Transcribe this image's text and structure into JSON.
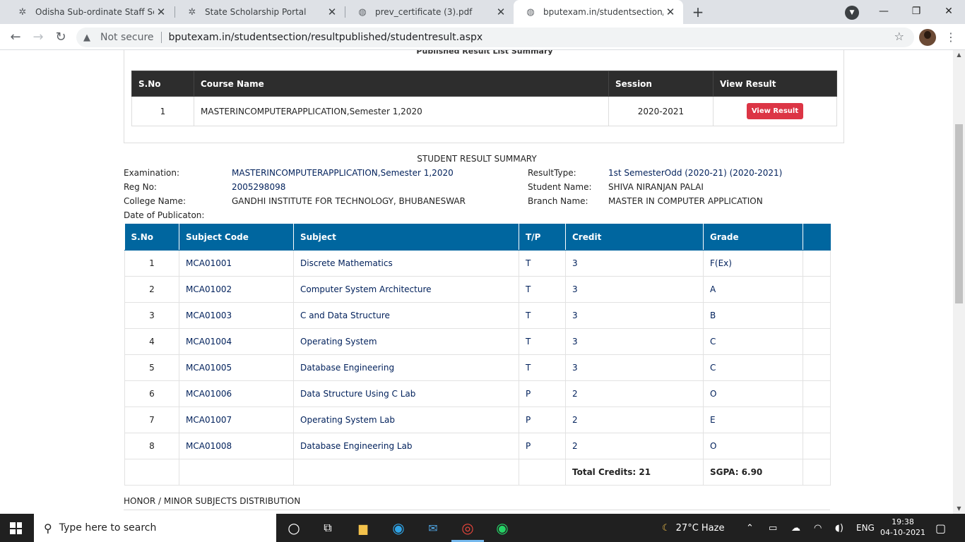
{
  "browser": {
    "tabs": [
      {
        "title": "Odisha Sub-ordinate Staff Selecti",
        "icon": "osssc-icon",
        "active": false
      },
      {
        "title": "State Scholarship Portal",
        "icon": "scholarship-icon",
        "active": false
      },
      {
        "title": "prev_certificate (3).pdf",
        "icon": "globe-icon",
        "active": false
      },
      {
        "title": "bputexam.in/studentsection/resu",
        "icon": "globe-icon",
        "active": true
      }
    ],
    "new_tab": "+",
    "address": {
      "security": "Not secure",
      "url": "bputexam.in/studentsection/resultpublished/studentresult.aspx"
    }
  },
  "published": {
    "heading": "Published Result  List Summary",
    "headers": [
      "S.No",
      "Course Name",
      "Session",
      "View Result"
    ],
    "row": {
      "sno": "1",
      "course": "MASTERINCOMPUTERAPPLICATION,Semester 1,2020",
      "session": "2020-2021",
      "button": "View Result"
    }
  },
  "summary": {
    "title": "STUDENT RESULT SUMMARY",
    "examination_label": "Examination:",
    "examination": "MASTERINCOMPUTERAPPLICATION,Semester 1,2020",
    "regno_label": "Reg No:",
    "regno": "2005298098",
    "college_label": "College Name:",
    "college": "GANDHI INSTITUTE FOR TECHNOLOGY, BHUBANESWAR",
    "date_label": "Date of Publicaton:",
    "resulttype_label": "ResultType:",
    "resulttype": "1st SemesterOdd (2020-21) (2020-2021)",
    "student_label": "Student Name:",
    "student": "SHIVA NIRANJAN PALAI",
    "branch_label": "Branch Name:",
    "branch": "MASTER IN COMPUTER APPLICATION"
  },
  "grades": {
    "headers": [
      "S.No",
      "Subject Code",
      "Subject",
      "T/P",
      "Credit",
      "Grade",
      ""
    ],
    "rows": [
      {
        "sno": "1",
        "code": "MCA01001",
        "subject": "Discrete Mathematics",
        "tp": "T",
        "credit": "3",
        "grade": "F(Ex)"
      },
      {
        "sno": "2",
        "code": "MCA01002",
        "subject": "Computer System Architecture",
        "tp": "T",
        "credit": "3",
        "grade": "A"
      },
      {
        "sno": "3",
        "code": "MCA01003",
        "subject": "C and Data Structure",
        "tp": "T",
        "credit": "3",
        "grade": "B"
      },
      {
        "sno": "4",
        "code": "MCA01004",
        "subject": "Operating System",
        "tp": "T",
        "credit": "3",
        "grade": "C"
      },
      {
        "sno": "5",
        "code": "MCA01005",
        "subject": "Database Engineering",
        "tp": "T",
        "credit": "3",
        "grade": "C"
      },
      {
        "sno": "6",
        "code": "MCA01006",
        "subject": "Data Structure Using C Lab",
        "tp": "P",
        "credit": "2",
        "grade": "O"
      },
      {
        "sno": "7",
        "code": "MCA01007",
        "subject": "Operating System Lab",
        "tp": "P",
        "credit": "2",
        "grade": "E"
      },
      {
        "sno": "8",
        "code": "MCA01008",
        "subject": "Database Engineering Lab",
        "tp": "P",
        "credit": "2",
        "grade": "O"
      }
    ],
    "total_credits": "Total Credits: 21",
    "sgpa": "SGPA: 6.90"
  },
  "honor_heading": "HONOR / MINOR SUBJECTS DISTRIBUTION",
  "taskbar": {
    "search_placeholder": "Type here to search",
    "weather": "27°C  Haze",
    "language": "ENG",
    "time": "19:38",
    "date": "04-10-2021"
  },
  "colors": {
    "grade_header": "#00669f",
    "list_header": "#2d2d2d",
    "view_button": "#dc3545",
    "value_text": "#00205b"
  }
}
